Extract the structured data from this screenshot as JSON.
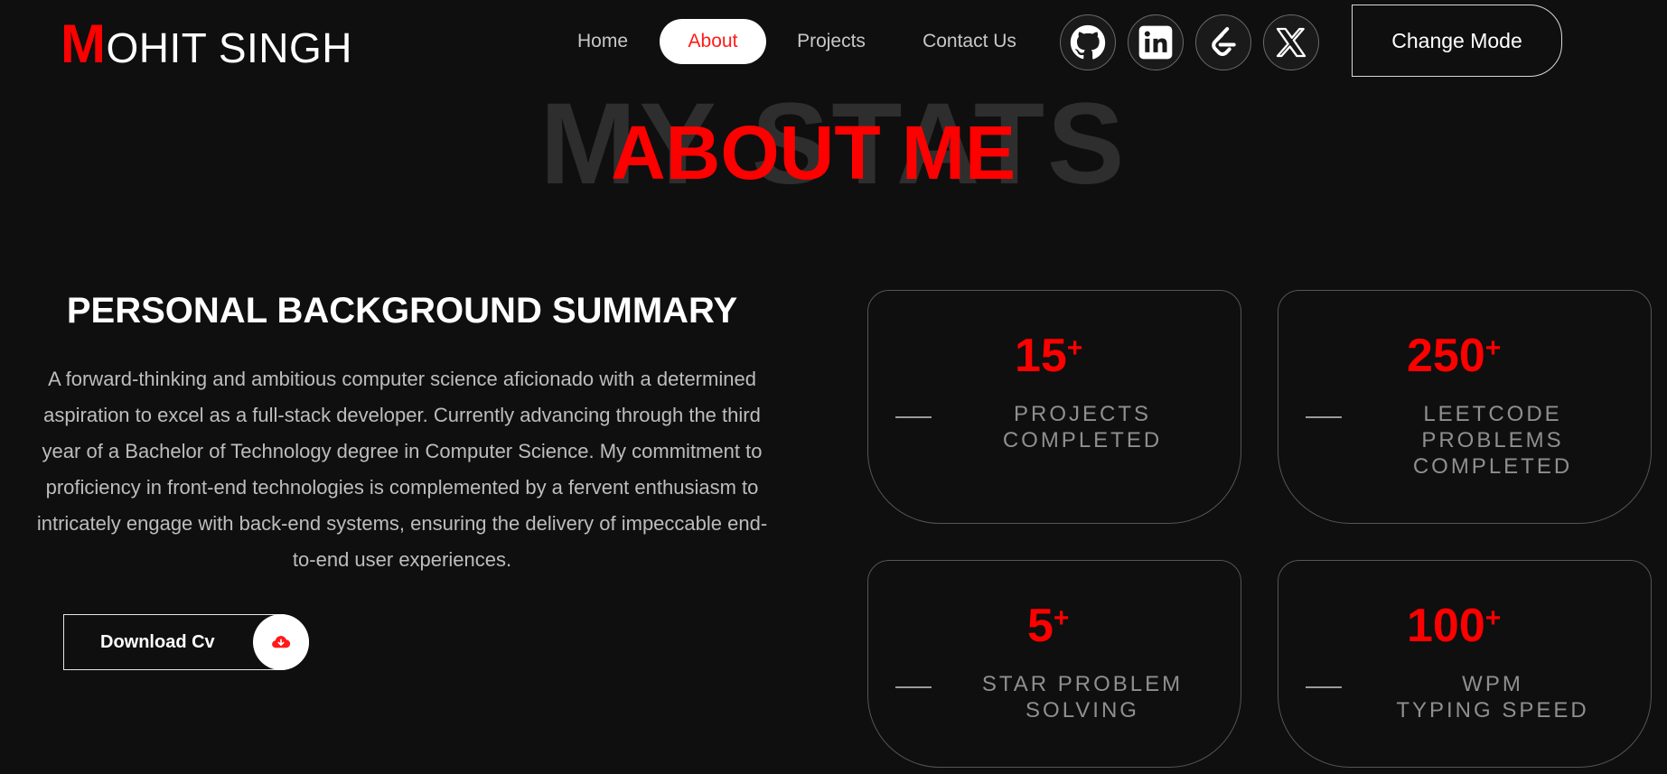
{
  "header": {
    "logo_first_letter": "M",
    "logo_rest": "OHIT SINGH",
    "nav": [
      {
        "label": "Home",
        "active": false
      },
      {
        "label": "About",
        "active": true
      },
      {
        "label": "Projects",
        "active": false
      },
      {
        "label": "Contact Us",
        "active": false
      }
    ],
    "social_icons": [
      "github-icon",
      "linkedin-icon",
      "leetcode-icon",
      "x-twitter-icon"
    ],
    "mode_button_label": "Change Mode"
  },
  "section": {
    "background_heading": "MY STATS",
    "heading": "ABOUT ME",
    "title": "PERSONAL BACKGROUND SUMMARY",
    "summary": "A forward-thinking and ambitious computer science aficionado with a determined aspiration to excel as a full-stack developer. Currently advancing through the third year of a Bachelor of Technology degree in Computer Science. My commitment to proficiency in front-end technologies is complemented by a fervent enthusiasm to intricately engage with back-end systems, ensuring the delivery of impeccable end-to-end user experiences.",
    "download_label": "Download Cv",
    "download_icon": "cloud-download-icon"
  },
  "stats": [
    {
      "number": "15",
      "suffix": "+",
      "label": "PROJECTS\nCOMPLETED"
    },
    {
      "number": "250",
      "suffix": "+",
      "label": "LEETCODE\nPROBLEMS\nCOMPLETED"
    },
    {
      "number": "5",
      "suffix": "+",
      "label": "STAR PROBLEM\nSOLVING"
    },
    {
      "number": "100",
      "suffix": "+",
      "label": "WPM\nTYPING SPEED"
    }
  ],
  "colors": {
    "background": "#0f0f0f",
    "accent": "#ff0000",
    "text": "#ffffff",
    "muted": "#8f8f8f"
  }
}
